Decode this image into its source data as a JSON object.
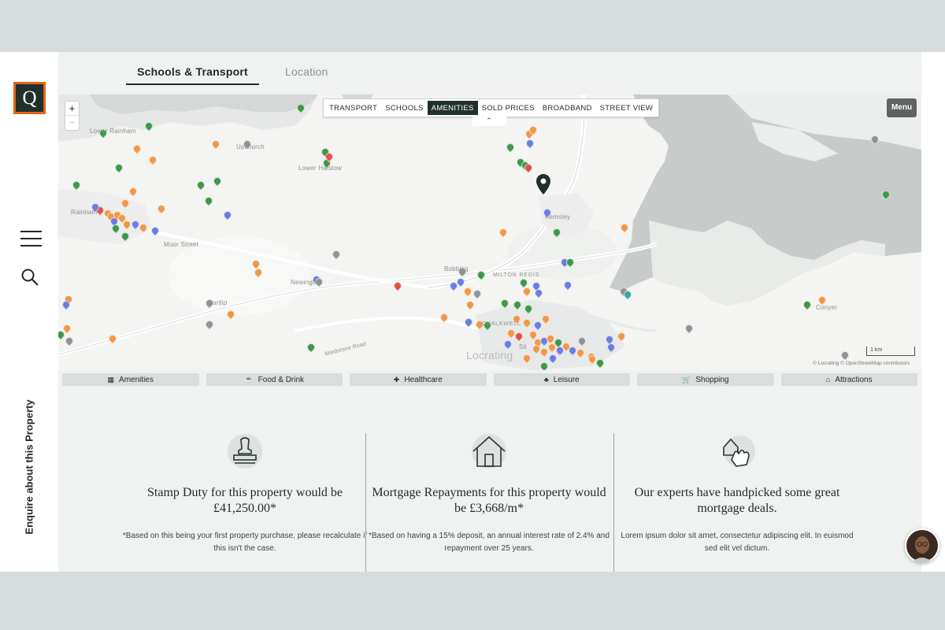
{
  "brand": {
    "logo_letter": "Q",
    "accent": "#e4621b",
    "dark": "#20302c"
  },
  "sidebar": {
    "enquire_label": "Enquire about this Property"
  },
  "tabs": [
    {
      "label": "Schools & Transport",
      "active": true
    },
    {
      "label": "Location",
      "active": false
    }
  ],
  "map": {
    "layers": [
      "TRANSPORT",
      "SCHOOLS",
      "AMENITIES",
      "SOLD PRICES",
      "BROADBAND",
      "STREET VIEW"
    ],
    "active_layer": "AMENITIES",
    "menu_label": "Menu",
    "zoom_in": "+",
    "zoom_out": "−",
    "collapse_glyph": "⌃",
    "scale_label": "1 km",
    "attribution": "© Locrating © OpenStreetMap contributors",
    "place_labels": {
      "lower_rainham": "Lower Rainham",
      "upchurch": "Upchurch",
      "lower_halstow": "Lower Halstow",
      "rainham": "Rainham",
      "moor_street": "Moor Street",
      "newington": "Newington",
      "hartlip": "Hartlip",
      "kemsley": "Kemsley",
      "bobbing": "Bobbing",
      "milton_regis": "MILTON REGIS",
      "chalkwell": "CHALKWELL",
      "sittingbourne": "Sit",
      "locrating": "Locrating",
      "conyer": "Conyer",
      "maidstone_road": "Maidstone Road"
    }
  },
  "categories": [
    {
      "label": "Amenities",
      "icon": "building-icon",
      "glyph": "▦"
    },
    {
      "label": "Food & Drink",
      "icon": "coffee-icon",
      "glyph": "☕"
    },
    {
      "label": "Healthcare",
      "icon": "medical-bag-icon",
      "glyph": "✚"
    },
    {
      "label": "Leisure",
      "icon": "tree-icon",
      "glyph": "♣"
    },
    {
      "label": "Shopping",
      "icon": "cart-icon",
      "glyph": "🛒"
    },
    {
      "label": "Attractions",
      "icon": "landmark-icon",
      "glyph": "⌂"
    }
  ],
  "cards": [
    {
      "icon": "stamp-icon",
      "title": "Stamp Duty for this property would be £41,250.00*",
      "note": "*Based on this being your first property purchase, please recalculate if this isn't the case."
    },
    {
      "icon": "house-icon",
      "title": "Mortgage Repayments for this property would be £3,668/m*",
      "note": "*Based on having a 15% deposit, an annual interest rate of 2.4% and repayment over 25 years."
    },
    {
      "icon": "hand-house-icon",
      "title": "Our experts have handpicked some great mortgage deals.",
      "note": "Lorem ipsum dolor sit amet, consectetur adipiscing elit. In euismod sed elit vel dictum."
    }
  ]
}
